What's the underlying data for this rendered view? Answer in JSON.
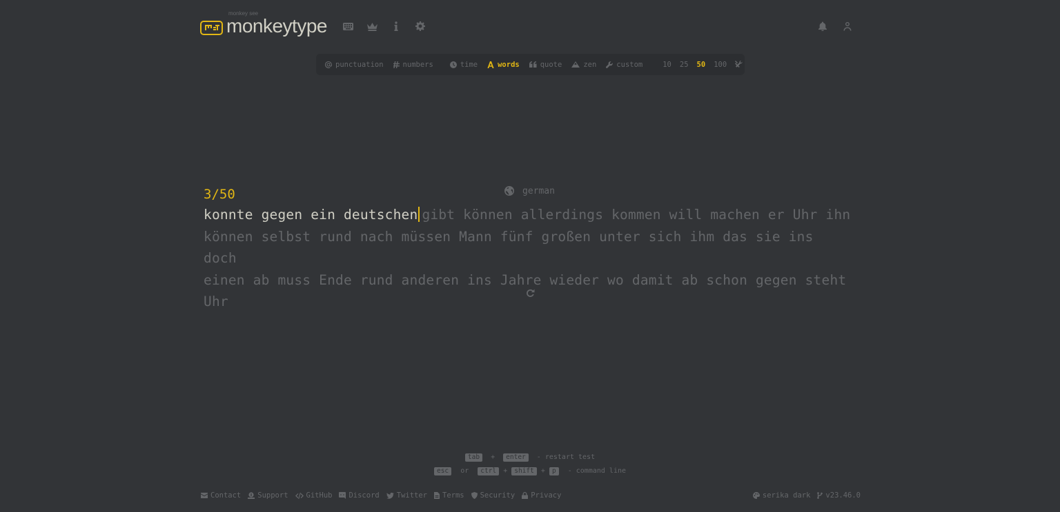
{
  "header": {
    "logo_top": "monkey see",
    "logo_text": "monkeytype",
    "nav": [
      {
        "icon": "keyboard-icon",
        "label": "test"
      },
      {
        "icon": "crown-icon",
        "label": "leaderboards"
      },
      {
        "icon": "info-icon",
        "label": "about"
      },
      {
        "icon": "gear-icon",
        "label": "settings"
      }
    ],
    "right": [
      {
        "icon": "bell-icon",
        "label": "notifications"
      },
      {
        "icon": "user-icon",
        "label": "account"
      }
    ]
  },
  "config": {
    "punctuation": "punctuation",
    "numbers": "numbers",
    "time": "time",
    "words": "words",
    "quote": "quote",
    "zen": "zen",
    "custom": "custom",
    "word_counts": [
      "10",
      "25",
      "50",
      "100"
    ],
    "selected_mode": "words",
    "selected_count": "50"
  },
  "test": {
    "language": "german",
    "counter": "3/50",
    "typed": "konnte gegen ein deutschen",
    "remaining_line1": "gibt können allerdings kommen will machen er Uhr ihn",
    "line2": "können selbst rund nach müssen Mann fünf großen unter sich ihm das sie ins doch",
    "line3": "einen ab muss Ende rund anderen ins Jahre wieder wo damit ab schon gegen steht Uhr"
  },
  "hints": {
    "tab": "tab",
    "plus": "+",
    "enter": "enter",
    "restart_text": "- restart test",
    "esc": "esc",
    "or": "or",
    "ctrl": "ctrl",
    "shift": "shift",
    "p": "p",
    "command_text": "- command line"
  },
  "footer": {
    "links": [
      "Contact",
      "Support",
      "GitHub",
      "Discord",
      "Twitter",
      "Terms",
      "Security",
      "Privacy"
    ],
    "theme": "serika dark",
    "version": "v23.46.0"
  },
  "colors": {
    "background": "#323437",
    "sub": "#646669",
    "main": "#e2b714",
    "text": "#d1d0c5",
    "sub_alt": "#2c2e31"
  }
}
